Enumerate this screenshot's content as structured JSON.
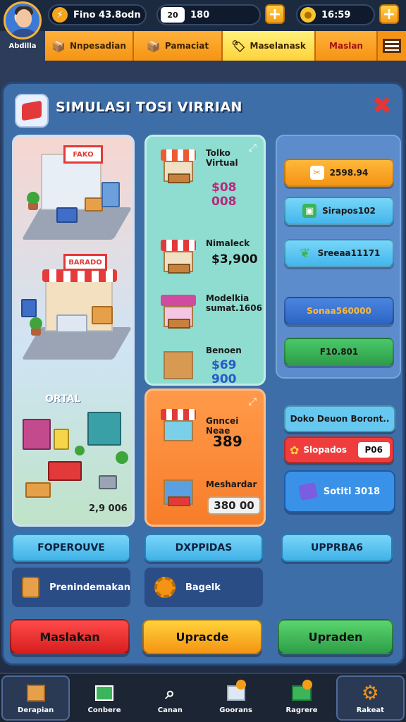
{
  "profile": {
    "name": "Abdilla"
  },
  "top_bar": {
    "stat1": {
      "text": "Fino 43.8odn",
      "icon": "lightning-icon"
    },
    "stat2": {
      "box": "20",
      "text": "180"
    },
    "stat3": {
      "text": "16:59",
      "icon": "coin-icon"
    }
  },
  "nav_tabs": [
    {
      "label": "Nnpesadian",
      "icon": "box-icon"
    },
    {
      "label": "Pamaciat",
      "icon": "box-icon"
    },
    {
      "label": "Maselanask",
      "icon": "tag-icon"
    },
    {
      "label": "Maslan",
      "icon": ""
    }
  ],
  "panel": {
    "title": "SIMULASI TOSI VIRRIAN",
    "column1": {
      "sign1": "FAKO",
      "sign2": "BARADO",
      "section_label": "ORTAL",
      "price": "2,9 006"
    },
    "items": [
      {
        "name": "Tolko Virtual",
        "price": "$08 008"
      },
      {
        "name": "Nimaleck",
        "price": "$3,900"
      },
      {
        "name": "Modelkia sumat.1606",
        "price": ""
      },
      {
        "name": "Benoen",
        "price": "$69 900"
      }
    ],
    "featured": [
      {
        "name": "Gnncei Neae",
        "price": "389"
      },
      {
        "name": "Meshardar",
        "price": "380 00"
      }
    ],
    "right_buttons": [
      "2598.94",
      "Sirapos102",
      "Sreeaa11171",
      "Sonaa560000",
      "F10.801"
    ],
    "right_lower": {
      "info_label": "Doko Deuon Boront..",
      "sale_label": "Slopados",
      "sale_value": "P06",
      "big_button": "Sotiti 3018"
    },
    "mid_row": [
      "FOPEROUVE",
      "DXPPIDAS",
      "UPPRBA6"
    ],
    "subpanels": [
      "Prenindemakan",
      "Bagelk"
    ],
    "actions": [
      "Maslakan",
      "Upracde",
      "Upraden"
    ]
  },
  "bottom_nav": [
    {
      "label": "Derapian",
      "icon": "box-icon"
    },
    {
      "label": "Conbere",
      "icon": "picture-icon"
    },
    {
      "label": "Canan",
      "icon": "search-icon"
    },
    {
      "label": "Goorans",
      "icon": "gift-icon"
    },
    {
      "label": "Ragrere",
      "icon": "card-icon"
    },
    {
      "label": "Rakeat",
      "icon": "gear-icon"
    }
  ],
  "colors": {
    "orange_button": "#f7a01e",
    "blue_button": "#58c3ef",
    "navy_button": "#3a76d8",
    "green_button": "#3cb45a",
    "red_button": "#ef3d3d",
    "yellow_tab": "#ffe35a"
  }
}
